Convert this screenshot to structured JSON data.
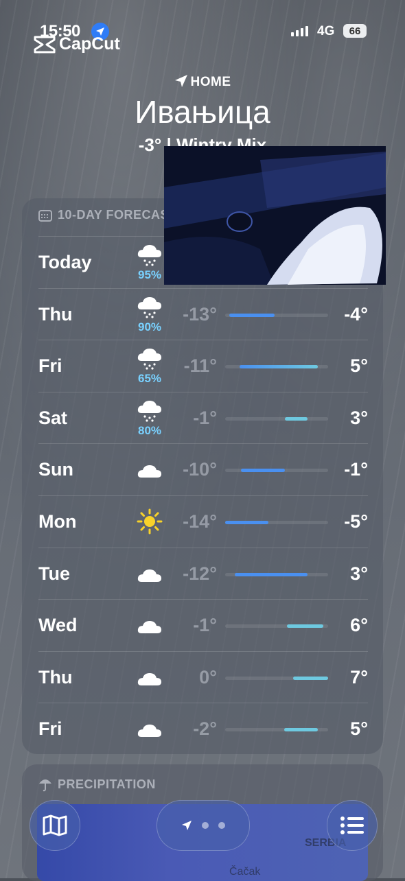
{
  "status_bar": {
    "time": "15:50",
    "network": "4G",
    "battery": "66"
  },
  "capcut": {
    "label": "CapCut"
  },
  "header": {
    "home_label": "HOME",
    "city": "Ивањица",
    "current": "-3°  |  Wintry Mix"
  },
  "forecast": {
    "title": "10-DAY FORECAST",
    "days": [
      {
        "day": "Today",
        "icon": "snow-cloud-icon",
        "precip": "95%",
        "low": "",
        "high": "",
        "bar": null
      },
      {
        "day": "Thu",
        "icon": "snow-cloud-icon",
        "precip": "90%",
        "low": "-13°",
        "high": "-4°",
        "bar": [
          0.04,
          0.48
        ]
      },
      {
        "day": "Fri",
        "icon": "snow-cloud-icon",
        "precip": "65%",
        "low": "-11°",
        "high": "5°",
        "bar": [
          0.14,
          0.9
        ]
      },
      {
        "day": "Sat",
        "icon": "snow-cloud-icon",
        "precip": "80%",
        "low": "-1°",
        "high": "3°",
        "bar": [
          0.58,
          0.8
        ]
      },
      {
        "day": "Sun",
        "icon": "cloud-icon",
        "precip": "",
        "low": "-10°",
        "high": "-1°",
        "bar": [
          0.15,
          0.58
        ]
      },
      {
        "day": "Mon",
        "icon": "sun-icon",
        "precip": "",
        "low": "-14°",
        "high": "-5°",
        "bar": [
          0.0,
          0.42
        ]
      },
      {
        "day": "Tue",
        "icon": "cloud-icon",
        "precip": "",
        "low": "-12°",
        "high": "3°",
        "bar": [
          0.09,
          0.8
        ]
      },
      {
        "day": "Wed",
        "icon": "cloud-icon",
        "precip": "",
        "low": "-1°",
        "high": "6°",
        "bar": [
          0.6,
          0.95
        ]
      },
      {
        "day": "Thu",
        "icon": "cloud-icon",
        "precip": "",
        "low": "0°",
        "high": "7°",
        "bar": [
          0.66,
          1.0
        ]
      },
      {
        "day": "Fri",
        "icon": "cloud-icon",
        "precip": "",
        "low": "-2°",
        "high": "5°",
        "bar": [
          0.57,
          0.9
        ]
      }
    ]
  },
  "precipitation": {
    "title": "PRECIPITATION",
    "map_labels": [
      "SERBIA",
      "Čačak"
    ]
  },
  "colors": {
    "cold": "#4a90f0",
    "mild": "#6ec9e0"
  }
}
